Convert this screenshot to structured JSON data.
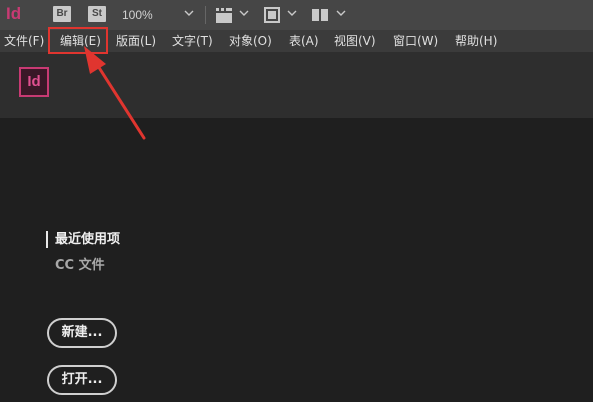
{
  "toolbar": {
    "app_icon": "Id",
    "bridge_label": "Br",
    "stock_label": "St",
    "zoom": "100%",
    "icons": [
      "frame-view-icon",
      "screen-mode-icon",
      "arrange-documents-icon",
      "chevron-down-icon"
    ]
  },
  "menubar": {
    "items": [
      "文件(F)",
      "编辑(E)",
      "版面(L)",
      "文字(T)",
      "对象(O)",
      "表(A)",
      "视图(V)",
      "窗口(W)",
      "帮助(H)"
    ]
  },
  "home": {
    "logo": "Id",
    "recent_label": "最近使用项",
    "cc_files_label": "CC 文件",
    "new_button": "新建...",
    "open_button": "打开..."
  },
  "colors": {
    "brand": "#c83a73",
    "highlight": "#e0352f",
    "toolbar_bg": "#464646",
    "menubar_bg": "#3b3b3b",
    "header_bg": "#2e2e2e",
    "body_bg": "#1f1f1f"
  }
}
